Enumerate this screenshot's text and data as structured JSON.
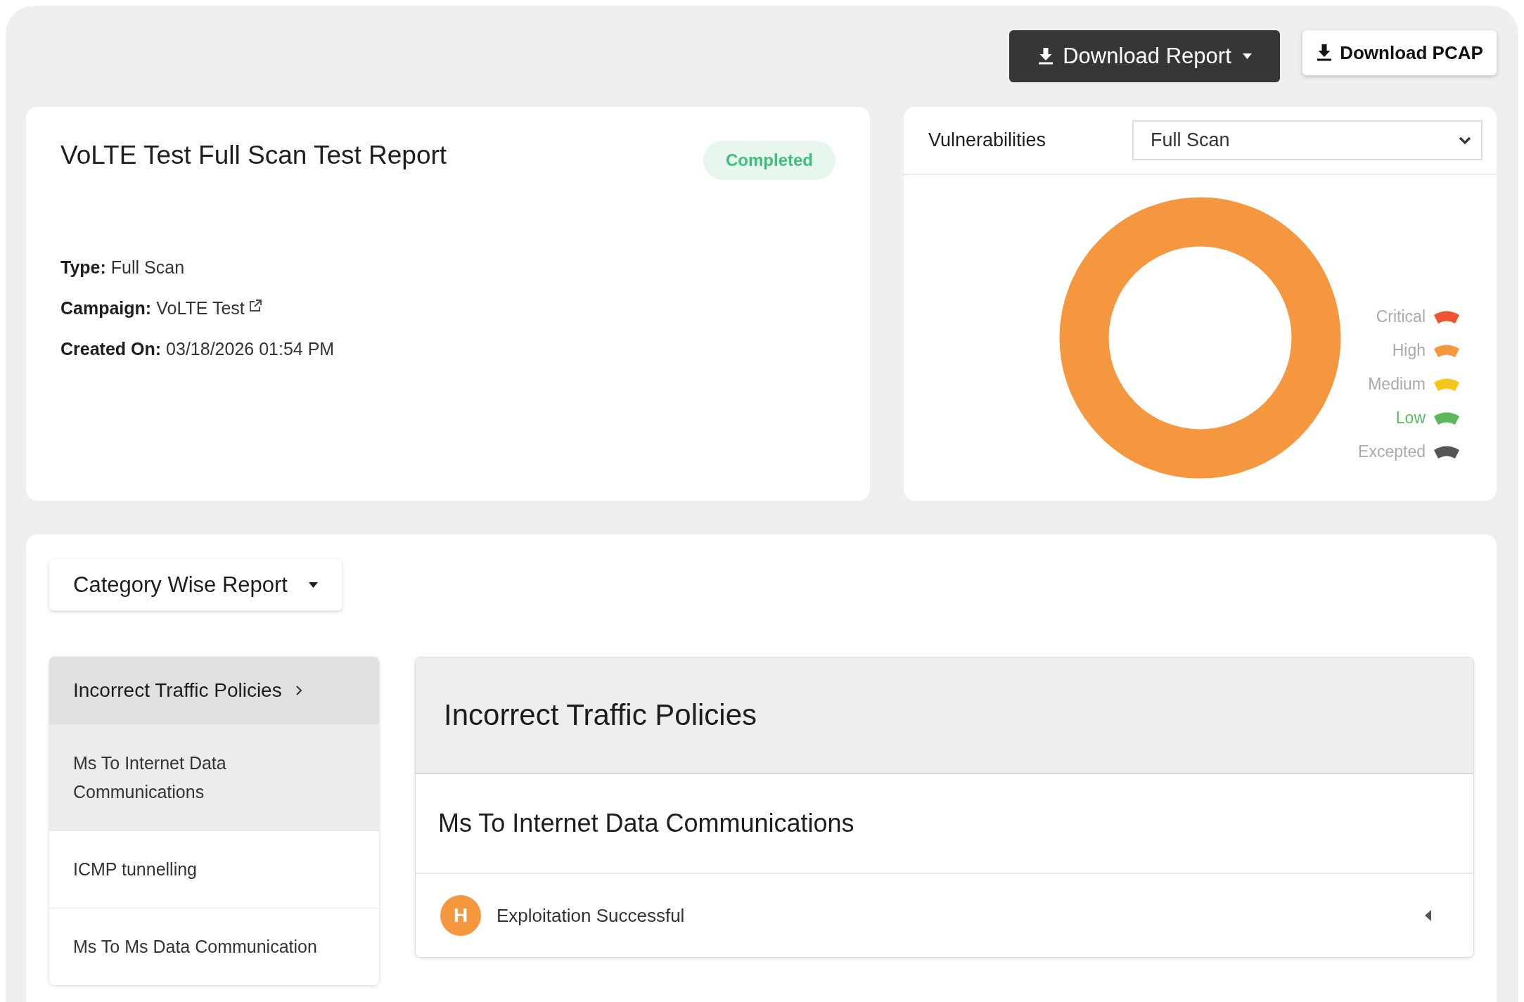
{
  "toolbar": {
    "buttons": [
      {
        "label": "Download Report",
        "kind": "dropdown"
      },
      {
        "label": "Download PCAP",
        "kind": "plain"
      }
    ]
  },
  "report": {
    "title": "VoLTE Test Full Scan Test Report",
    "status": "Completed",
    "details": [
      {
        "label": "Type:",
        "value": "Full Scan",
        "kind": "text"
      },
      {
        "label": "Campaign:",
        "value": "VoLTE Test",
        "kind": "link"
      },
      {
        "label": "Created On:",
        "value": "03/18/2026 01:54 PM",
        "kind": "text"
      }
    ]
  },
  "vulnerabilities": {
    "title": "Vulnerabilities",
    "filter": {
      "value": "Full Scan"
    },
    "legend": [
      {
        "label": "Critical",
        "color": "#ee5332",
        "highlighted": false
      },
      {
        "label": "High",
        "color": "#f4973f",
        "highlighted": false
      },
      {
        "label": "Medium",
        "color": "#f5c518",
        "highlighted": false
      },
      {
        "label": "Low",
        "color": "#5cb85c",
        "highlighted": true
      },
      {
        "label": "Excepted",
        "color": "#555555",
        "highlighted": false
      }
    ]
  },
  "category_report": {
    "view_button": "Category Wise Report",
    "categories": [
      {
        "label": "Incorrect Traffic Policies",
        "children": [
          {
            "label": "Ms To Internet Data Communications",
            "selected": true
          },
          {
            "label": "ICMP tunnelling",
            "selected": false
          },
          {
            "label": "Ms To Ms Data Communication",
            "selected": false
          }
        ]
      }
    ],
    "detail": {
      "title": "Incorrect Traffic Policies",
      "subtitle": "Ms To Internet Data Communications",
      "findings": [
        {
          "badge": "H",
          "label": "Exploitation Successful",
          "color": "#f4973f",
          "expanded": false
        }
      ]
    }
  }
}
